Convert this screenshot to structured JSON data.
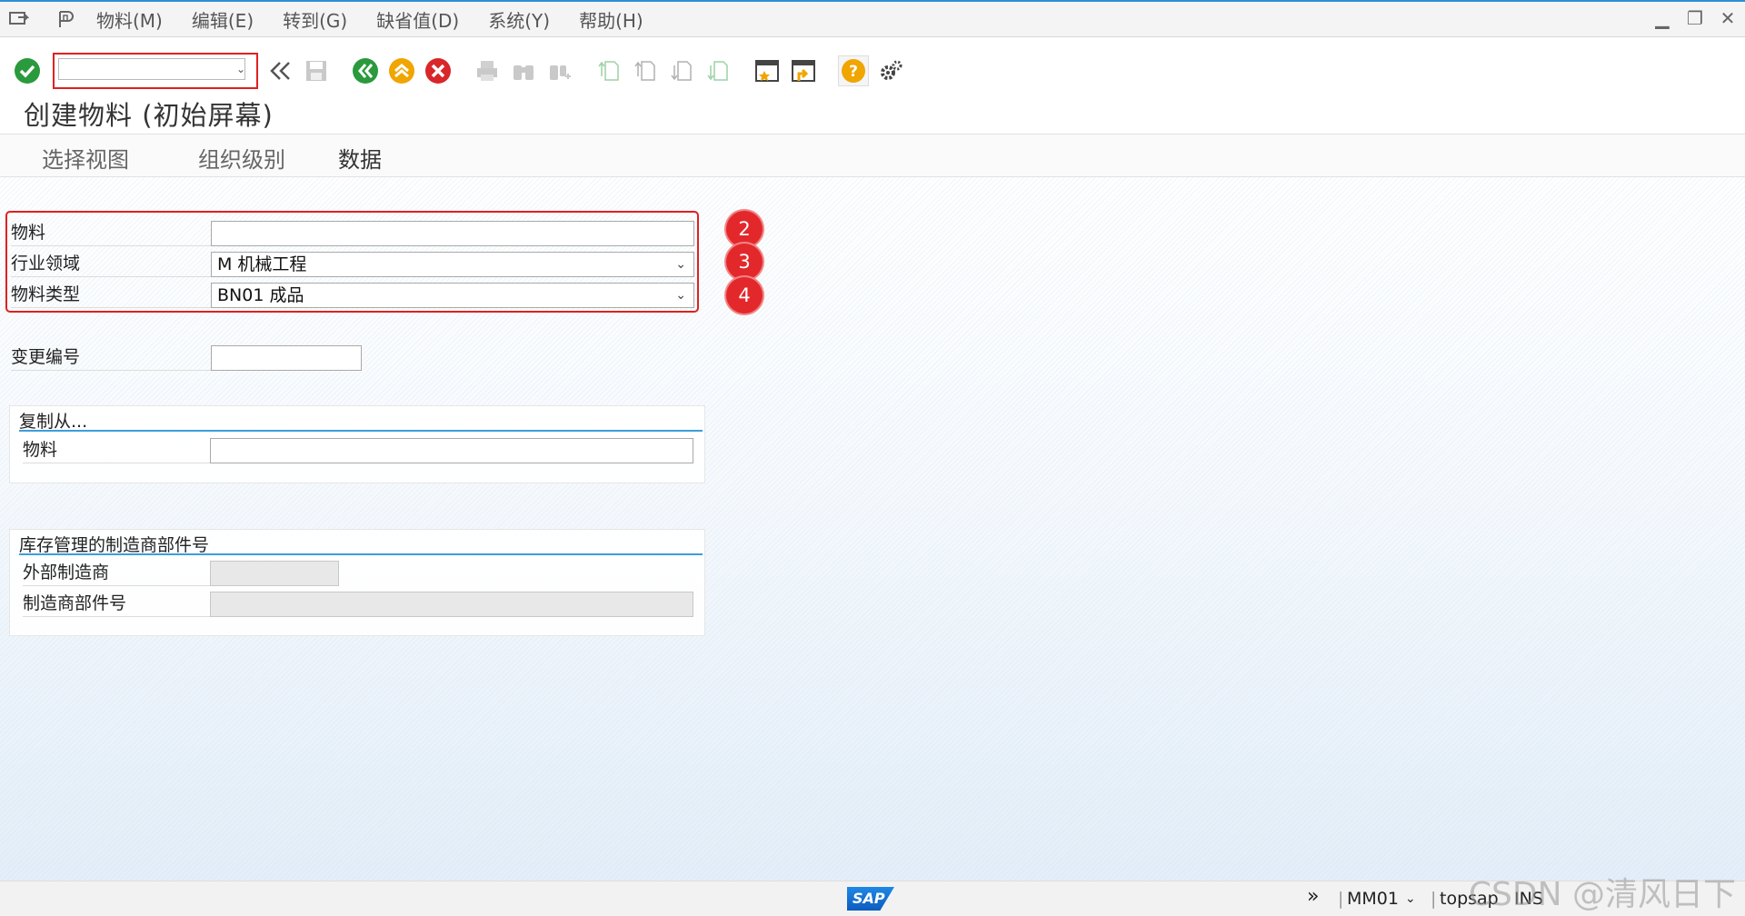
{
  "menu": {
    "items": [
      "物料(M)",
      "编辑(E)",
      "转到(G)",
      "缺省值(D)",
      "系统(Y)",
      "帮助(H)"
    ]
  },
  "window_controls": [
    "minimize-icon",
    "restore-icon",
    "close-icon"
  ],
  "toolbar": {
    "command_field_value": "",
    "icons": [
      "enter-icon",
      "back-nav-icon",
      "save-icon",
      "back-icon",
      "exit-icon",
      "cancel-icon",
      "print-icon",
      "find-icon",
      "find-next-icon",
      "first-page-icon",
      "previous-page-icon",
      "next-page-icon",
      "last-page-icon",
      "new-session-icon",
      "shortcut-icon",
      "help-icon",
      "settings-icon"
    ]
  },
  "title": "创建物料 (初始屏幕)",
  "app_toolbar": {
    "buttons": [
      "选择视图",
      "组织级别",
      "数据"
    ]
  },
  "form": {
    "material_label": "物料",
    "material_value": "",
    "industry_label": "行业领域",
    "industry_value": "M 机械工程",
    "material_type_label": "物料类型",
    "material_type_value": "BN01 成品",
    "change_number_label": "变更编号",
    "change_number_value": "",
    "badges": [
      "2",
      "3",
      "4"
    ]
  },
  "copy_from": {
    "title": "复制从...",
    "material_label": "物料",
    "material_value": ""
  },
  "mpn_group": {
    "title": "库存管理的制造商部件号",
    "ext_manufacturer_label": "外部制造商",
    "ext_manufacturer_value": "",
    "mpn_label": "制造商部件号",
    "mpn_value": ""
  },
  "status": {
    "logo": "SAP",
    "transaction": "MM01",
    "server": "topsap",
    "mode": "INS",
    "watermark": "CSDN @清风日下"
  }
}
